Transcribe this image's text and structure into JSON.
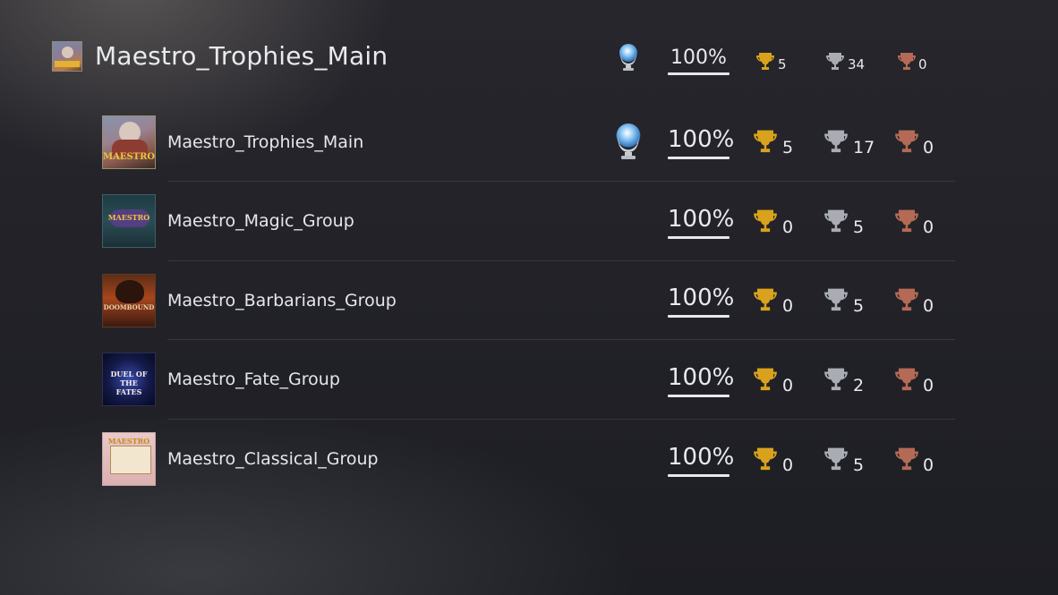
{
  "header": {
    "title": "Maestro_Trophies_Main",
    "percent": "100%",
    "gold": "5",
    "silver": "34",
    "bronze": "0",
    "icon": "maestro-game-icon"
  },
  "groups": [
    {
      "name": "Maestro_Trophies_Main",
      "percent": "100%",
      "has_platinum": true,
      "gold": "5",
      "silver": "17",
      "bronze": "0",
      "thumb_text": "MAESTRO",
      "icon": "maestro-main-thumbnail"
    },
    {
      "name": "Maestro_Magic_Group",
      "percent": "100%",
      "has_platinum": false,
      "gold": "0",
      "silver": "5",
      "bronze": "0",
      "thumb_text": "MAESTRO",
      "icon": "magic-group-thumbnail"
    },
    {
      "name": "Maestro_Barbarians_Group",
      "percent": "100%",
      "has_platinum": false,
      "gold": "0",
      "silver": "5",
      "bronze": "0",
      "thumb_text": "DOOMBOUND",
      "icon": "barbarians-group-thumbnail"
    },
    {
      "name": "Maestro_Fate_Group",
      "percent": "100%",
      "has_platinum": false,
      "gold": "0",
      "silver": "2",
      "bronze": "0",
      "thumb_text": "DUEL OF THE FATES",
      "icon": "fate-group-thumbnail"
    },
    {
      "name": "Maestro_Classical_Group",
      "percent": "100%",
      "has_platinum": false,
      "gold": "0",
      "silver": "5",
      "bronze": "0",
      "thumb_text": "MAESTRO",
      "icon": "classical-group-thumbnail"
    }
  ],
  "colors": {
    "gold": "#d9a21c",
    "silver": "#a9adb3",
    "bronze": "#b46a55",
    "platinum": "#9fd0f5"
  }
}
